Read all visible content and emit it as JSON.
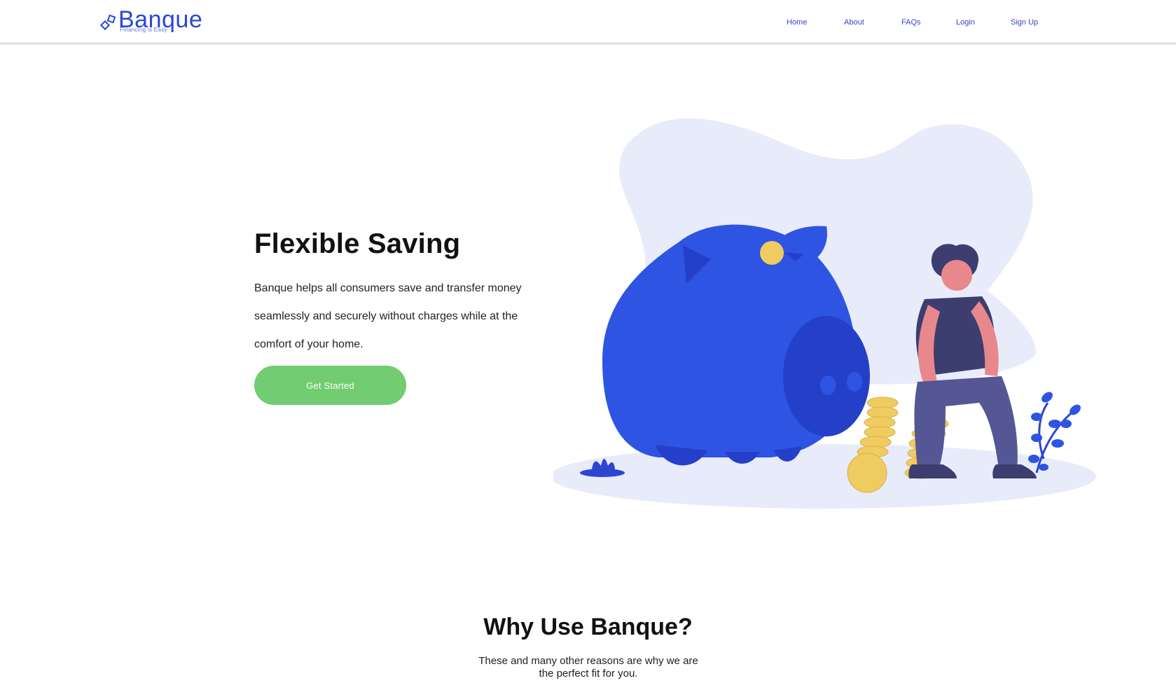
{
  "brand": {
    "name": "Banque",
    "tagline": "Financing is Easy",
    "accent": "#2c46d2"
  },
  "nav": {
    "items": [
      {
        "label": "Home"
      },
      {
        "label": "About"
      },
      {
        "label": "FAQs"
      },
      {
        "label": "Login"
      },
      {
        "label": "Sign Up"
      }
    ]
  },
  "hero": {
    "title": "Flexible Saving",
    "body": "Banque helps all consumers save and transfer money seamlessly and securely without charges while at the comfort of your home.",
    "cta_label": "Get Started",
    "cta_color": "#72cc72",
    "illustration": "piggy-bank-illustration"
  },
  "why": {
    "title": "Why Use Banque?",
    "subtitle": "These and many other reasons are why we are the perfect fit for you."
  }
}
